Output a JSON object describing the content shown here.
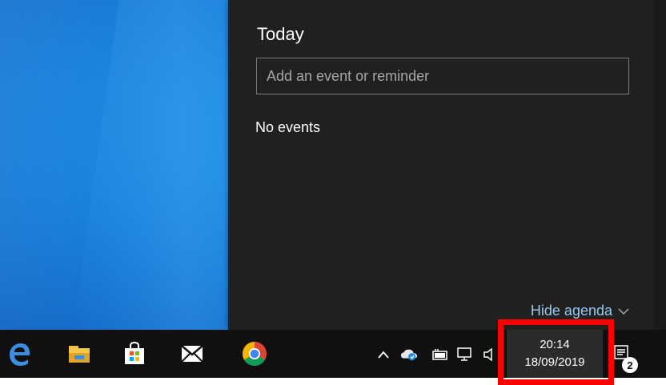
{
  "agenda": {
    "title": "Today",
    "event_placeholder": "Add an event or reminder",
    "empty_text": "No events",
    "hide_label": "Hide agenda"
  },
  "taskbar": {
    "pinned": [
      {
        "name": "edge-icon"
      },
      {
        "name": "file-explorer-icon"
      },
      {
        "name": "store-icon"
      },
      {
        "name": "mail-icon"
      },
      {
        "name": "chrome-icon"
      }
    ],
    "tray_icons": [
      "chevron-up-icon",
      "onedrive-icon",
      "battery-icon",
      "network-icon",
      "volume-icon"
    ],
    "clock": {
      "time": "20:14",
      "date": "18/09/2019"
    },
    "notification_count": "2"
  },
  "colors": {
    "desktop_accent": "#0f7ad8",
    "panel_bg": "#202020",
    "taskbar_bg": "#101010",
    "link": "#9ac8f0",
    "highlight": "#ff0000"
  }
}
